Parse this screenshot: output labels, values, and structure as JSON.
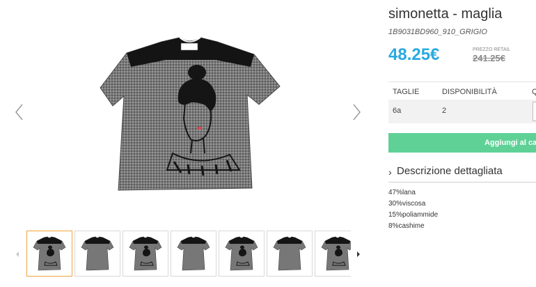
{
  "product": {
    "title": "simonetta - maglia",
    "sku": "1B9031BD960_910_GRIGIO",
    "price": "48.25€",
    "retail_label": "PREZZO RETAIL",
    "retail_price": "241.25€"
  },
  "size_table": {
    "headers": [
      "TAGLIE",
      "DISPONIBILITÀ",
      "Q"
    ],
    "rows": [
      {
        "size": "6a",
        "availability": "2"
      }
    ]
  },
  "add_to_cart_label": "Aggiungi al carrello",
  "description": {
    "header": "Descrizione dettagliata",
    "composition": [
      "47%lana",
      "30%viscosa",
      "15%poliammide",
      "8%cashime"
    ]
  },
  "gallery": {
    "thumbnail_count": 7,
    "active_index": 0,
    "icons": {
      "prev": "chevron-left-icon",
      "next": "chevron-right-icon"
    }
  },
  "colors": {
    "price": "#2aa9e0",
    "button": "#5fd196",
    "active_thumb": "#f0a43a"
  }
}
